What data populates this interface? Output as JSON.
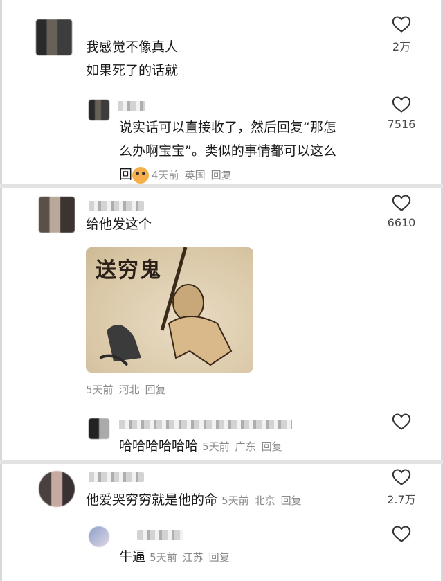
{
  "comments": [
    {
      "text_line1": "我感觉不像真人",
      "text_line2": "如果死了的话就",
      "likes": "2万",
      "reply": {
        "text_line1": "说实话可以直接收了，然后回复“那怎",
        "text_line2": "么办啊宝宝”。类似的事情都可以这么",
        "text_line3_prefix": "回",
        "time": "4天前",
        "location": "英国",
        "reply_label": "回复",
        "likes": "7516"
      }
    },
    {
      "text": "给他发这个",
      "likes": "6610",
      "image_caption": "送穷鬼",
      "time": "5天前",
      "location": "河北",
      "reply_label": "回复",
      "reply": {
        "text": "哈哈哈哈哈哈",
        "time": "5天前",
        "location": "广东",
        "reply_label": "回复"
      }
    },
    {
      "text": "他爱哭穷穷就是他的命",
      "time": "5天前",
      "location": "北京",
      "reply_label": "回复",
      "likes": "2.7万",
      "reply": {
        "text": "牛逼",
        "time": "5天前",
        "location": "江苏",
        "reply_label": "回复"
      }
    }
  ]
}
